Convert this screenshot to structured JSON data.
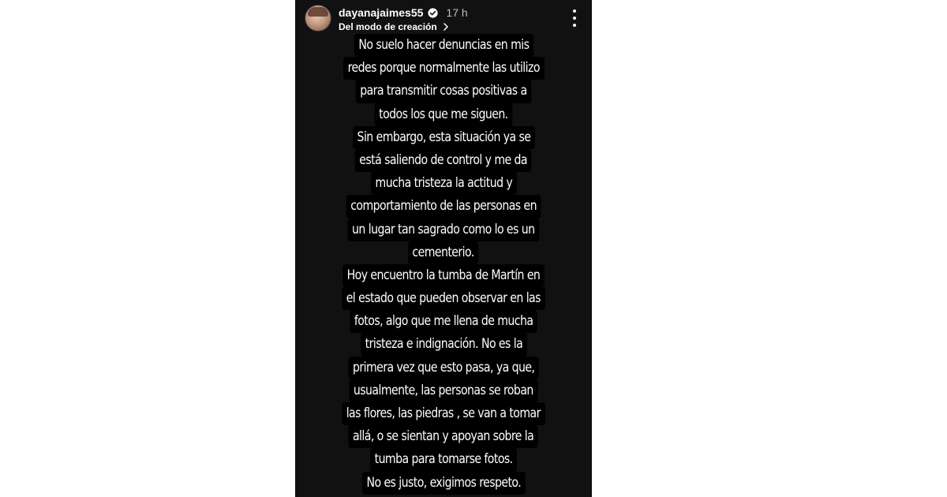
{
  "story": {
    "username": "dayanajaimes55",
    "time": "17 h",
    "subtitle": "Del modo de creación",
    "lines": [
      "No suelo hacer denuncias en mis",
      "redes porque normalmente las utilizo",
      "para transmitir cosas positivas a",
      "todos los que me siguen.",
      "Sin embargo, esta situación ya se",
      "está saliendo de control y me da",
      "mucha tristeza la actitud y",
      "comportamiento de las personas en",
      "un lugar tan sagrado como lo es un",
      "cementerio.",
      "Hoy encuentro la tumba de Martín en",
      "el estado que pueden observar en las",
      "fotos, algo que me llena de mucha",
      "tristeza e indignación. No es la",
      "primera vez que esto pasa, ya que,",
      "usualmente, las personas se roban",
      "las flores, las piedras , se van a tomar",
      "allá, o se sientan y apoyan sobre la",
      "tumba para tomarse fotos.",
      "No es justo, exigimos respeto."
    ]
  },
  "icons": {
    "verified": "verified-badge-icon",
    "chevron": "chevron-right-icon",
    "more": "more-options-icon"
  },
  "colors": {
    "story_background": "#111111",
    "text_highlight": "#000000",
    "text": "#ffffff"
  }
}
